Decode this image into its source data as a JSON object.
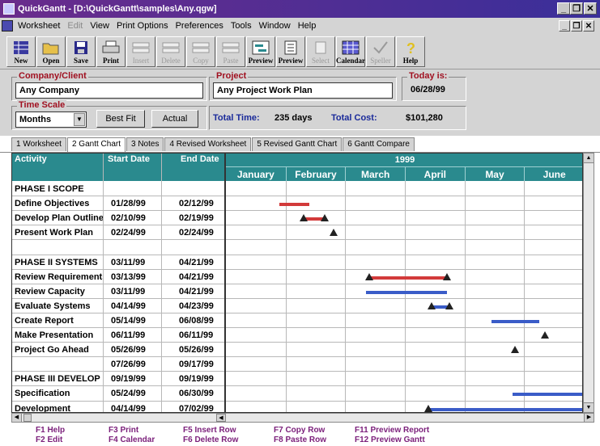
{
  "window": {
    "title": "QuickGantt - [D:\\QuickGantt\\samples\\Any.qgw]",
    "minimize": "_",
    "restore": "❐",
    "close": "✕",
    "child_min": "_",
    "child_restore": "❐",
    "child_close": "✕"
  },
  "menu": [
    "Worksheet",
    "Edit",
    "View",
    "Print Options",
    "Preferences",
    "Tools",
    "Window",
    "Help"
  ],
  "toolbar": [
    {
      "label": "New",
      "icon": "new-icon",
      "enabled": true
    },
    {
      "label": "Open",
      "icon": "open-folder-icon",
      "enabled": true
    },
    {
      "label": "Save",
      "icon": "save-disk-icon",
      "enabled": true
    },
    {
      "label": "Print",
      "icon": "printer-icon",
      "enabled": true
    },
    {
      "label": "Insert",
      "icon": "insert-row-icon",
      "enabled": false
    },
    {
      "label": "Delete",
      "icon": "delete-row-icon",
      "enabled": false
    },
    {
      "label": "Copy",
      "icon": "copy-icon",
      "enabled": false
    },
    {
      "label": "Paste",
      "icon": "paste-icon",
      "enabled": false
    },
    {
      "label": "Preview",
      "icon": "preview-gantt-icon",
      "enabled": true
    },
    {
      "label": "Preview",
      "icon": "preview-report-icon",
      "enabled": true
    },
    {
      "label": "Select",
      "icon": "select-icon",
      "enabled": false
    },
    {
      "label": "Calendar",
      "icon": "calendar-icon",
      "enabled": true
    },
    {
      "label": "Speller",
      "icon": "speller-check-icon",
      "enabled": false
    },
    {
      "label": "Help",
      "icon": "help-question-icon",
      "enabled": true
    }
  ],
  "company": {
    "label": "Company/Client",
    "value": "Any Company"
  },
  "project": {
    "label": "Project",
    "value": "Any Project Work Plan"
  },
  "today": {
    "label": "Today is:",
    "value": "06/28/99"
  },
  "time_scale": {
    "label": "Time Scale",
    "value": "Months",
    "best_fit": "Best Fit",
    "actual": "Actual"
  },
  "totals": {
    "time_label": "Total Time:",
    "time_value": "235 days",
    "cost_label": "Total Cost:",
    "cost_value": "$101,280"
  },
  "tabs": [
    "1 Worksheet",
    "2 Gantt Chart",
    "3 Notes",
    "4 Revised Worksheet",
    "5 Revised Gantt Chart",
    "6 Gantt Compare"
  ],
  "columns": {
    "activity": "Activity",
    "start": "Start Date",
    "end": "End Date"
  },
  "gantt_header": {
    "year": "1999",
    "months": [
      "January",
      "February",
      "March",
      "April",
      "May",
      "June"
    ]
  },
  "rows": [
    {
      "activity": "PHASE I SCOPE",
      "start": "",
      "end": ""
    },
    {
      "activity": "Define Objectives",
      "start": "01/28/99",
      "end": "02/12/99"
    },
    {
      "activity": "Develop Plan Outline",
      "start": "02/10/99",
      "end": "02/19/99"
    },
    {
      "activity": "Present Work Plan",
      "start": "02/24/99",
      "end": "02/24/99"
    },
    {
      "activity": "",
      "start": "",
      "end": ""
    },
    {
      "activity": "PHASE II SYSTEMS",
      "start": "03/11/99",
      "end": "04/21/99"
    },
    {
      "activity": "Review Requirements",
      "start": "03/13/99",
      "end": "04/21/99"
    },
    {
      "activity": "Review Capacity",
      "start": "03/11/99",
      "end": "04/21/99"
    },
    {
      "activity": "Evaluate Systems",
      "start": "04/14/99",
      "end": "04/23/99"
    },
    {
      "activity": "Create Report",
      "start": "05/14/99",
      "end": "06/08/99"
    },
    {
      "activity": "Make Presentation",
      "start": "06/11/99",
      "end": "06/11/99"
    },
    {
      "activity": "Project Go Ahead",
      "start": "05/26/99",
      "end": "05/26/99"
    },
    {
      "activity": "",
      "start": "07/26/99",
      "end": "09/17/99"
    },
    {
      "activity": "PHASE III DEVELOP",
      "start": "09/19/99",
      "end": "09/19/99"
    },
    {
      "activity": "Specification",
      "start": "05/24/99",
      "end": "06/30/99"
    },
    {
      "activity": "Development",
      "start": "04/14/99",
      "end": "07/02/99"
    }
  ],
  "bars": [
    {
      "row": 1,
      "start_month": 0.9,
      "end_month": 1.4,
      "kind": "bar",
      "color": "#d23a3a"
    },
    {
      "row": 2,
      "start_month": 1.3,
      "end_month": 1.65,
      "kind": "bar-ends",
      "color": "#d23a3a"
    },
    {
      "row": 3,
      "start_month": 1.8,
      "end_month": 1.8,
      "kind": "milestone",
      "color": "#222222"
    },
    {
      "row": 6,
      "start_month": 2.4,
      "end_month": 3.7,
      "kind": "bar-ends",
      "color": "#d23a3a"
    },
    {
      "row": 7,
      "start_month": 2.35,
      "end_month": 3.7,
      "kind": "bar",
      "color": "#3a5cc8"
    },
    {
      "row": 8,
      "start_month": 3.45,
      "end_month": 3.75,
      "kind": "bar-ends",
      "color": "#3a5cc8"
    },
    {
      "row": 9,
      "start_month": 4.45,
      "end_month": 5.25,
      "kind": "bar",
      "color": "#3a5cc8"
    },
    {
      "row": 10,
      "start_month": 5.35,
      "end_month": 5.35,
      "kind": "milestone",
      "color": "#222222"
    },
    {
      "row": 11,
      "start_month": 4.85,
      "end_month": 4.85,
      "kind": "milestone",
      "color": "#222222"
    },
    {
      "row": 14,
      "start_month": 4.8,
      "end_month": 6.0,
      "kind": "bar",
      "color": "#3a5cc8"
    },
    {
      "row": 15,
      "start_month": 3.4,
      "end_month": 6.0,
      "kind": "bar-start",
      "color": "#3a5cc8"
    }
  ],
  "fkeys": [
    [
      "F1 Help",
      "F2 Edit"
    ],
    [
      "F3 Print",
      "F4 Calendar"
    ],
    [
      "F5 Insert Row",
      "F6 Delete Row"
    ],
    [
      "F7 Copy Row",
      "F8 Paste Row"
    ],
    [
      "F11 Preview Report",
      "F12 Preview Gantt"
    ]
  ]
}
